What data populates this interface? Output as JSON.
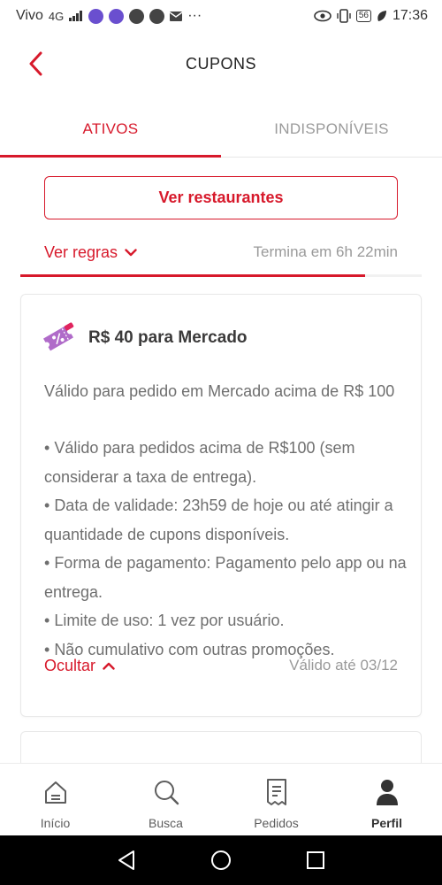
{
  "status_bar": {
    "carrier": "Vivo",
    "network": "4G",
    "time": "17:36",
    "battery": "56"
  },
  "header": {
    "title": "CUPONS",
    "back_icon": "chevron-left-icon"
  },
  "tabs": [
    {
      "label": "ATIVOS",
      "active": true
    },
    {
      "label": "INDISPONÍVEIS",
      "active": false
    }
  ],
  "previous_coupon": {
    "button_label": "Ver restaurantes",
    "rules_link": "Ver regras",
    "expiry_text": "Termina em 6h 22min",
    "time_remaining_fraction": 0.86
  },
  "coupon": {
    "icon": "ticket-percent-icon",
    "title": "R$ 40 para Mercado",
    "description": "Válido para pedido em Mercado acima de R$ 100",
    "rules": [
      "Válido para pedidos acima de R$100 (sem considerar a taxa de entrega).",
      "Data de validade: 23h59 de hoje ou até atingir a quantidade de cupons disponíveis.",
      "Forma de pagamento: Pagamento pelo app ou na entrega.",
      "Limite de uso: 1 vez por usuário.",
      "Não cumulativo com outras promoções."
    ],
    "hide_link": "Ocultar",
    "valid_until": "Válido até 03/12"
  },
  "bottom_nav": [
    {
      "label": "Início",
      "icon": "home-icon",
      "active": false
    },
    {
      "label": "Busca",
      "icon": "search-icon",
      "active": false
    },
    {
      "label": "Pedidos",
      "icon": "orders-icon",
      "active": false
    },
    {
      "label": "Perfil",
      "icon": "profile-icon",
      "active": true
    }
  ],
  "colors": {
    "accent": "#d7192b",
    "muted_text": "#9a9a9a",
    "coupon_icon": "#b06bc9"
  }
}
